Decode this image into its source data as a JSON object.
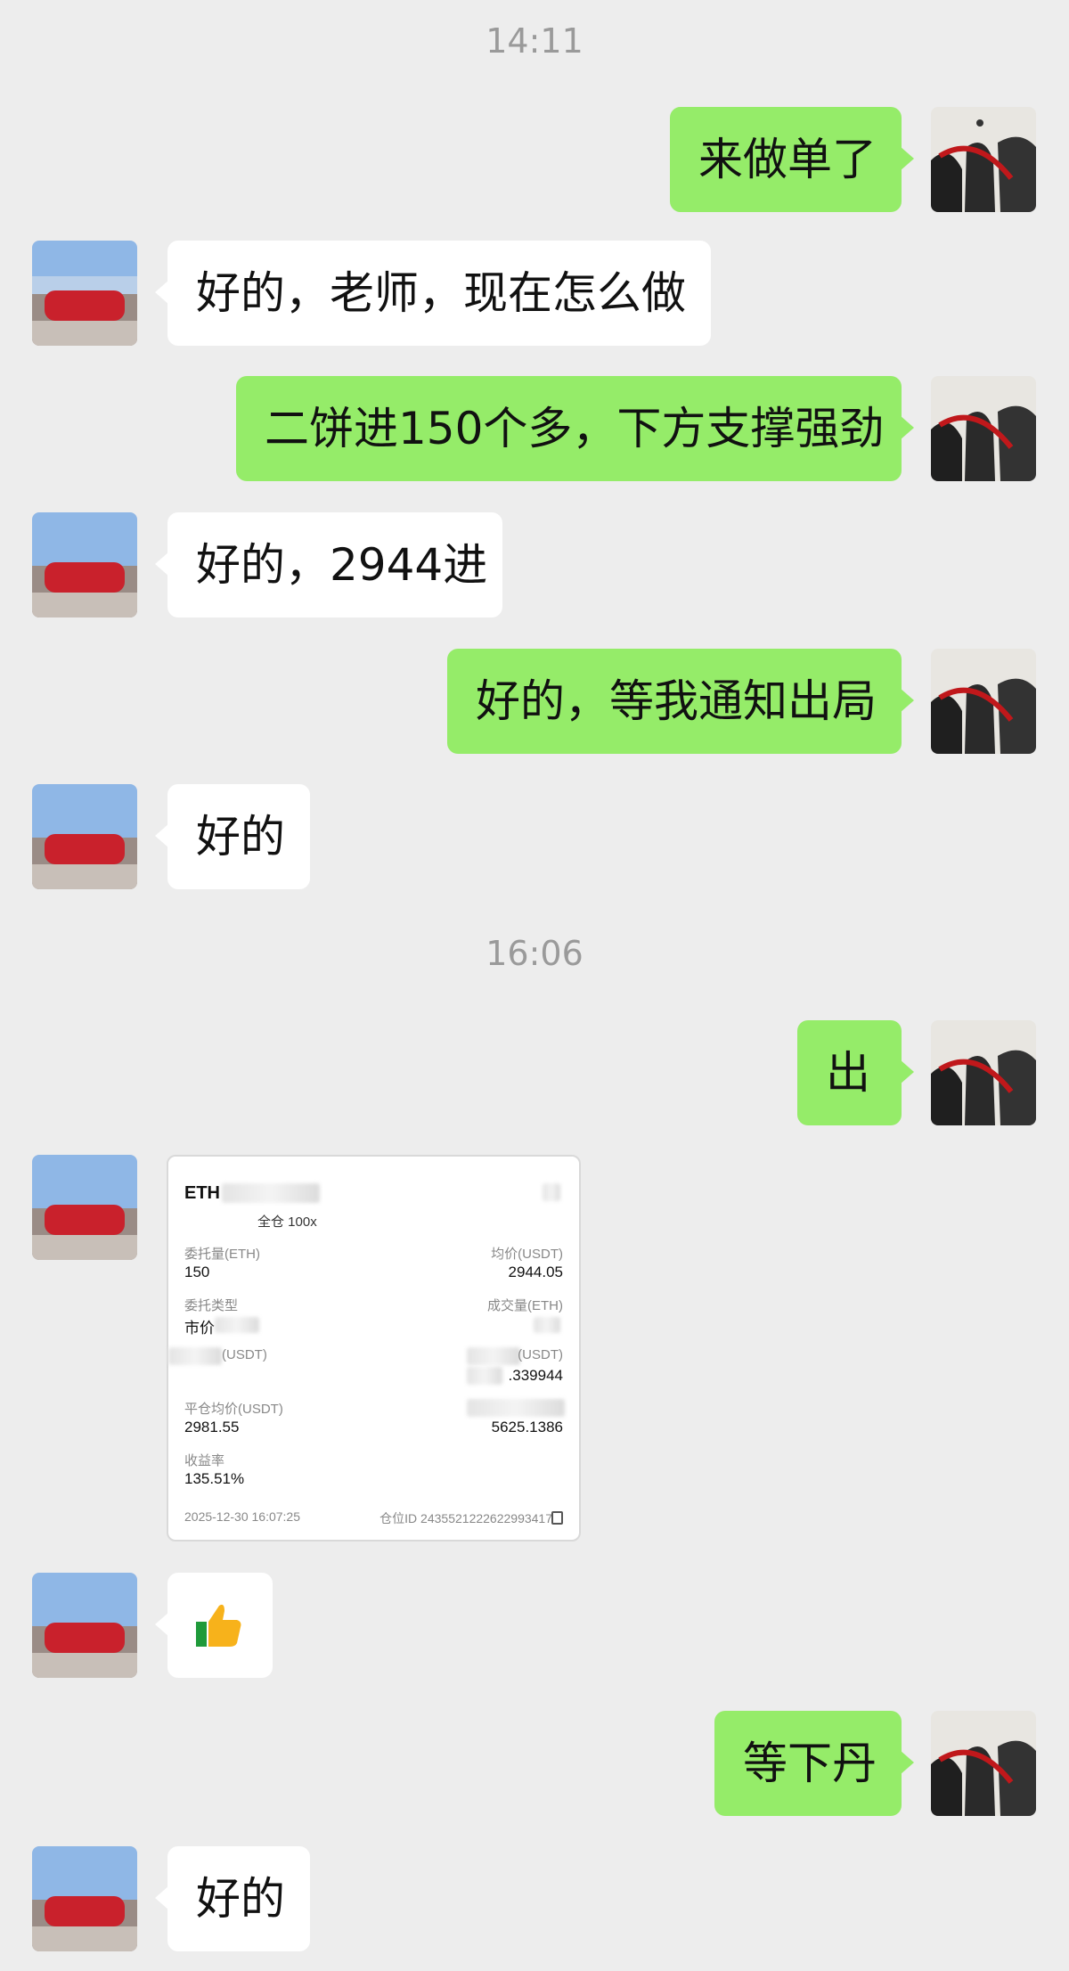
{
  "timestamps": [
    "14:11",
    "16:06"
  ],
  "messages": {
    "m1": "来做单了",
    "m2": "好的，老师，现在怎么做",
    "m3": "二饼进150个多，下方支撑强劲",
    "m4": "好的，2944进",
    "m5": "好的，等我通知出局",
    "m6": "好的",
    "m7": "出",
    "m9": "等下丹",
    "m10": "好的"
  },
  "thumbs_emoji": "👍",
  "order_card": {
    "symbol": "ETH",
    "margin": "全仓 100x",
    "order_qty_label": "委托量(ETH)",
    "order_qty": "150",
    "open_avg_label": "均价(USDT)",
    "open_avg": "2944.05",
    "order_type_label": "委托类型",
    "order_type": "市价",
    "filled_label": "成交量(ETH)",
    "fee_label": "(USDT)",
    "pnl_label": "(USDT)",
    "pnl": ".339944",
    "close_avg_label": "平仓均价(USDT)",
    "close_avg": "2981.55",
    "right_value": "5625.1386",
    "yield_label": "收益率",
    "yield": "135.51%",
    "time": "2025-12-30 16:07:25",
    "position_id": "仓位ID 2435521222622993417"
  },
  "colors": {
    "bg": "#ededed",
    "me_bubble": "#95ec69",
    "other_bubble": "#ffffff"
  }
}
